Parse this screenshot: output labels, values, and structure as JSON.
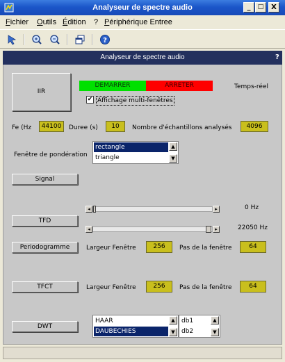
{
  "window": {
    "title": "Analyseur de spectre audio",
    "min": "_",
    "max": "□",
    "close": "X"
  },
  "menu": [
    "Fichier",
    "Outils",
    "Édition",
    "?",
    "Périphérique Entree"
  ],
  "panel": {
    "title": "Analyseur de spectre audio",
    "help": "?"
  },
  "filter_button": "IIR",
  "start_label": "DEMARRER",
  "stop_label": "ARRETER",
  "realtime_label": "Temps-réel",
  "multiwindow": {
    "label": "Affichage multi-fenêtres",
    "checked": "✔"
  },
  "params": {
    "fe_label": "Fe (Hz",
    "fe_value": "44100",
    "duree_label": "Duree (s)",
    "duree_value": "10",
    "nb_label": "Nombre d'échantillons analysés",
    "nb_value": "4096"
  },
  "window_fn": {
    "label": "Fenêtre de pondération",
    "options": [
      "rectangle",
      "triangle"
    ],
    "selected": "rectangle"
  },
  "signal_button": "Signal",
  "tfd": {
    "button": "TFD",
    "slider1_value": "0 Hz",
    "slider2_value": "22050 Hz"
  },
  "periodogramme": {
    "button": "Periodogramme",
    "largeur_label": "Largeur Fenêtre",
    "largeur_value": "256",
    "pas_label": "Pas de la fenêtre",
    "pas_value": "64"
  },
  "tfct": {
    "button": "TFCT",
    "largeur_label": "Largeur Fenêtre",
    "largeur_value": "256",
    "pas_label": "Pas de la fenêtre",
    "pas_value": "64"
  },
  "dwt": {
    "button": "DWT",
    "wavelets": [
      "HAAR",
      "DAUBECHIES"
    ],
    "selected": "DAUBECHIES",
    "orders": [
      "db1",
      "db2"
    ]
  },
  "colors": {
    "accent_start": "#00e000",
    "accent_stop": "#ff0000",
    "field": "#c9bf1d",
    "header": "#23305e"
  }
}
